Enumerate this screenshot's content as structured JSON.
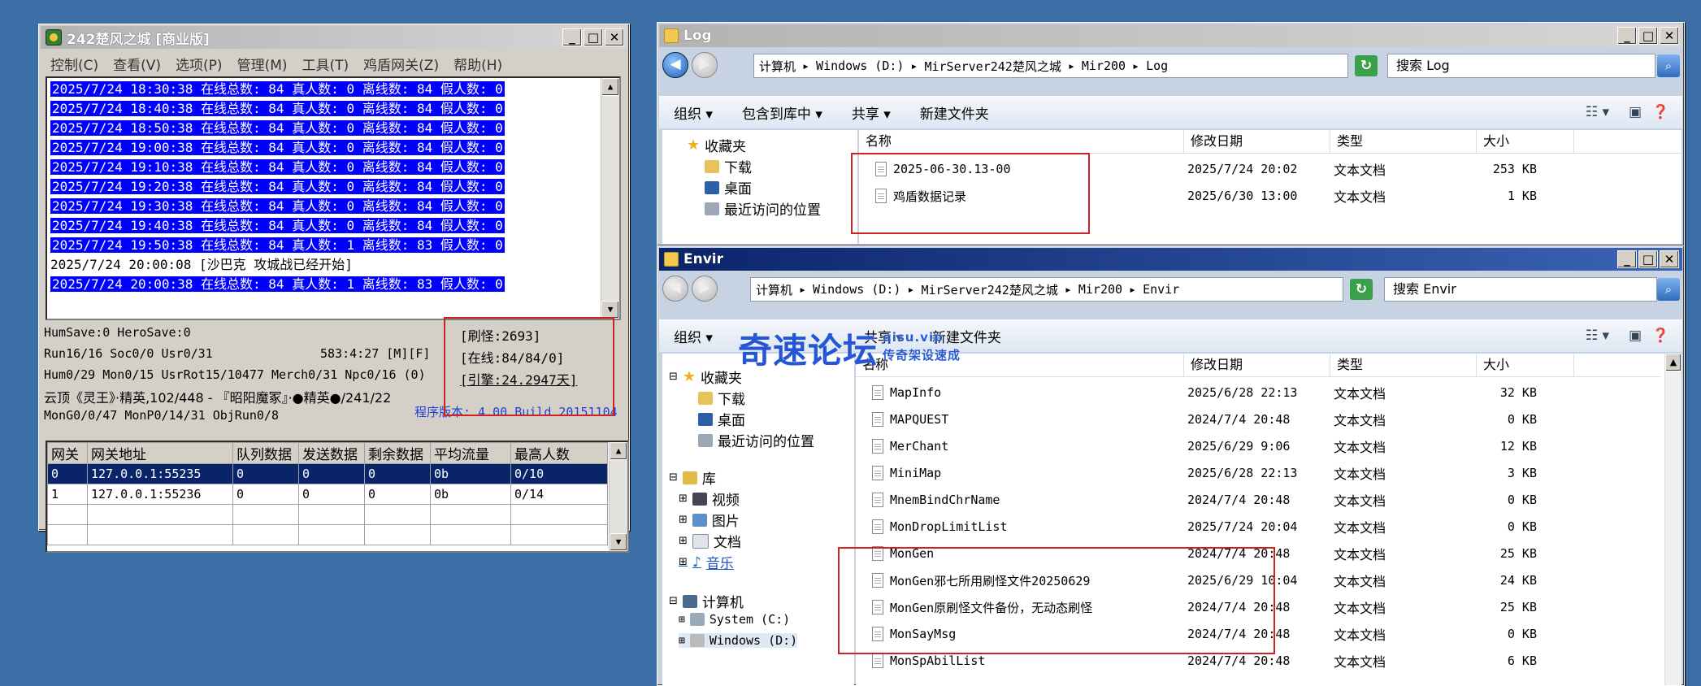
{
  "app": {
    "title": "242楚风之城 [商业版]",
    "menu": [
      "控制(C)",
      "查看(V)",
      "选项(P)",
      "管理(M)",
      "工具(T)",
      "鸡盾网关(Z)",
      "帮助(H)"
    ],
    "log_lines": [
      {
        "text": "2025/7/24 18:30:38 在线总数: 84 真人数: 0 离线数: 84 假人数: 0",
        "highlight": true
      },
      {
        "text": "2025/7/24 18:40:38 在线总数: 84 真人数: 0 离线数: 84 假人数: 0",
        "highlight": true
      },
      {
        "text": "2025/7/24 18:50:38 在线总数: 84 真人数: 0 离线数: 84 假人数: 0",
        "highlight": true
      },
      {
        "text": "2025/7/24 19:00:38 在线总数: 84 真人数: 0 离线数: 84 假人数: 0",
        "highlight": true
      },
      {
        "text": "2025/7/24 19:10:38 在线总数: 84 真人数: 0 离线数: 84 假人数: 0",
        "highlight": true
      },
      {
        "text": "2025/7/24 19:20:38 在线总数: 84 真人数: 0 离线数: 84 假人数: 0",
        "highlight": true
      },
      {
        "text": "2025/7/24 19:30:38 在线总数: 84 真人数: 0 离线数: 84 假人数: 0",
        "highlight": true
      },
      {
        "text": "2025/7/24 19:40:38 在线总数: 84 真人数: 0 离线数: 84 假人数: 0",
        "highlight": true
      },
      {
        "text": "2025/7/24 19:50:38 在线总数: 84 真人数: 1 离线数: 83 假人数: 0",
        "highlight": true
      },
      {
        "text": "2025/7/24 20:00:08 [沙巴克 攻城战已经开始]",
        "highlight": false
      },
      {
        "text": "2025/7/24 20:00:38 在线总数: 84 真人数: 1 离线数: 83 假人数: 0",
        "highlight": true
      }
    ],
    "status": {
      "l1": "HumSave:0 HeroSave:0",
      "l2a": "Run16/16 Soc0/0 Usr0/31",
      "l2b": "583:4:27 [M][F]",
      "l3": "Hum0/29 Mon0/15 UsrRot15/10477 Merch0/31 Npc0/16 (0)",
      "l4": "云顶《灵王》·精英,102/448 - 『昭阳魔冢』·●精英●/241/22",
      "l5": "MonG0/0/47 MonP0/14/31 ObjRun0/8",
      "version": "程序版本: 4.00 Build 20151104"
    },
    "info": [
      "[刷怪:2693]",
      "[在线:84/84/0]",
      "[引擎:24.2947天]"
    ],
    "grid": {
      "headers": [
        "网关",
        "网关地址",
        "队列数据",
        "发送数据",
        "剩余数据",
        "平均流量",
        "最高人数"
      ],
      "rows": [
        [
          "0",
          "127.0.0.1:55235",
          "0",
          "0",
          "0",
          "0b",
          "0/10"
        ],
        [
          "1",
          "127.0.0.1:55236",
          "0",
          "0",
          "0",
          "0b",
          "0/14"
        ]
      ]
    }
  },
  "log_window": {
    "title": "Log",
    "path": [
      "计算机",
      "Windows (D:)",
      "MirServer242楚风之城",
      "Mir200",
      "Log"
    ],
    "search_placeholder": "搜索 Log",
    "commands": [
      "组织 ▾",
      "包含到库中 ▾",
      "共享 ▾",
      "新建文件夹"
    ],
    "nav": [
      "收藏夹",
      "下载",
      "桌面",
      "最近访问的位置"
    ],
    "columns": [
      "名称",
      "修改日期",
      "类型",
      "大小"
    ],
    "files": [
      {
        "name": "2025-06-30.13-00",
        "date": "2025/7/24 20:02",
        "type": "文本文档",
        "size": "253 KB"
      },
      {
        "name": "鸡盾数据记录",
        "date": "2025/6/30 13:00",
        "type": "文本文档",
        "size": "1 KB"
      }
    ]
  },
  "envir_window": {
    "title": "Envir",
    "path": [
      "计算机",
      "Windows (D:)",
      "MirServer242楚风之城",
      "Mir200",
      "Envir"
    ],
    "search_placeholder": "搜索 Envir",
    "commands": [
      "组织 ▾",
      "共享 ▾",
      "新建文件夹"
    ],
    "nav": [
      "收藏夹",
      "下载",
      "桌面",
      "最近访问的位置",
      "库",
      "视频",
      "图片",
      "文档",
      "音乐",
      "计算机",
      "System (C:)",
      "Windows (D:)"
    ],
    "columns": [
      "名称",
      "修改日期",
      "类型",
      "大小"
    ],
    "files": [
      {
        "name": "MapInfo",
        "date": "2025/6/28 22:13",
        "type": "文本文档",
        "size": "32 KB"
      },
      {
        "name": "MAPQUEST",
        "date": "2024/7/4 20:48",
        "type": "文本文档",
        "size": "0 KB"
      },
      {
        "name": "MerChant",
        "date": "2025/6/29 9:06",
        "type": "文本文档",
        "size": "12 KB"
      },
      {
        "name": "MiniMap",
        "date": "2025/6/28 22:13",
        "type": "文本文档",
        "size": "3 KB"
      },
      {
        "name": "MnemBindChrName",
        "date": "2024/7/4 20:48",
        "type": "文本文档",
        "size": "0 KB"
      },
      {
        "name": "MonDropLimitList",
        "date": "2025/7/24 20:04",
        "type": "文本文档",
        "size": "0 KB"
      },
      {
        "name": "MonGen",
        "date": "2024/7/4 20:48",
        "type": "文本文档",
        "size": "25 KB"
      },
      {
        "name": "MonGen邪七所用刷怪文件20250629",
        "date": "2025/6/29 10:04",
        "type": "文本文档",
        "size": "24 KB"
      },
      {
        "name": "MonGen原刷怪文件备份，无动态刷怪",
        "date": "2024/7/4 20:48",
        "type": "文本文档",
        "size": "25 KB"
      },
      {
        "name": "MonSayMsg",
        "date": "2024/7/4 20:48",
        "type": "文本文档",
        "size": "0 KB"
      },
      {
        "name": "MonSpAbilList",
        "date": "2024/7/4 20:48",
        "type": "文本文档",
        "size": "6 KB"
      }
    ]
  },
  "watermark": {
    "main": "奇速论坛",
    "site": "qisu.vip",
    "tagline": "传奇架设速成"
  }
}
